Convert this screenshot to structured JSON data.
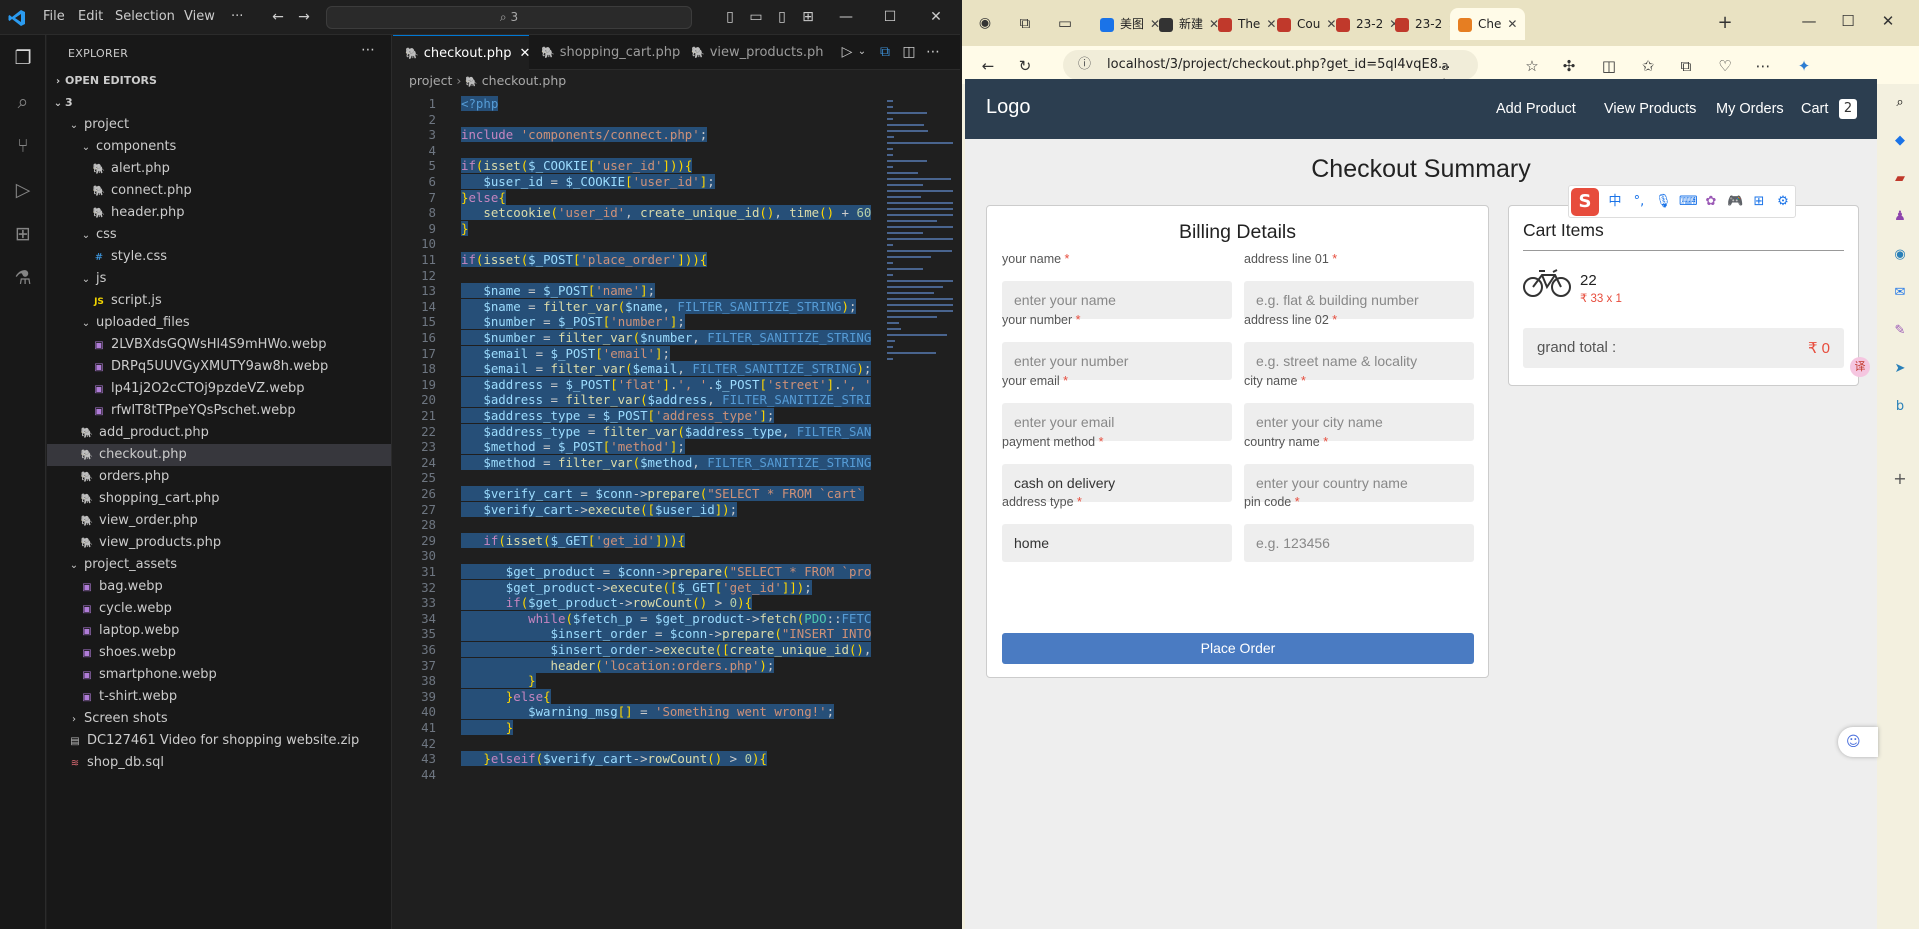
{
  "vscode": {
    "menu": [
      "File",
      "Edit",
      "Selection",
      "View",
      "···"
    ],
    "search": "3",
    "explorer_title": "EXPLORER",
    "open_editors": "OPEN EDITORS",
    "root_folder": "3",
    "tree": [
      {
        "label": "project",
        "depth": 1,
        "type": "folder"
      },
      {
        "label": "components",
        "depth": 2,
        "type": "folder"
      },
      {
        "label": "alert.php",
        "depth": 3,
        "type": "php"
      },
      {
        "label": "connect.php",
        "depth": 3,
        "type": "php"
      },
      {
        "label": "header.php",
        "depth": 3,
        "type": "php"
      },
      {
        "label": "css",
        "depth": 2,
        "type": "folder"
      },
      {
        "label": "style.css",
        "depth": 3,
        "type": "css"
      },
      {
        "label": "js",
        "depth": 2,
        "type": "folder"
      },
      {
        "label": "script.js",
        "depth": 3,
        "type": "js"
      },
      {
        "label": "uploaded_files",
        "depth": 2,
        "type": "folder"
      },
      {
        "label": "2LVBXdsGQWsHl4S9mHWo.webp",
        "depth": 3,
        "type": "img"
      },
      {
        "label": "DRPq5UUVGyXMUTY9aw8h.webp",
        "depth": 3,
        "type": "img"
      },
      {
        "label": "lp41j2O2cCTOj9pzdeVZ.webp",
        "depth": 3,
        "type": "img"
      },
      {
        "label": "rfwIT8tTPpeYQsPschet.webp",
        "depth": 3,
        "type": "img"
      },
      {
        "label": "add_product.php",
        "depth": 2,
        "type": "php"
      },
      {
        "label": "checkout.php",
        "depth": 2,
        "type": "php"
      },
      {
        "label": "orders.php",
        "depth": 2,
        "type": "php"
      },
      {
        "label": "shopping_cart.php",
        "depth": 2,
        "type": "php"
      },
      {
        "label": "view_order.php",
        "depth": 2,
        "type": "php"
      },
      {
        "label": "view_products.php",
        "depth": 2,
        "type": "php"
      },
      {
        "label": "project_assets",
        "depth": 1,
        "type": "folder"
      },
      {
        "label": "bag.webp",
        "depth": 2,
        "type": "img"
      },
      {
        "label": "cycle.webp",
        "depth": 2,
        "type": "img"
      },
      {
        "label": "laptop.webp",
        "depth": 2,
        "type": "img"
      },
      {
        "label": "shoes.webp",
        "depth": 2,
        "type": "img"
      },
      {
        "label": "smartphone.webp",
        "depth": 2,
        "type": "img"
      },
      {
        "label": "t-shirt.webp",
        "depth": 2,
        "type": "img"
      },
      {
        "label": "Screen shots",
        "depth": 1,
        "type": "folder-closed"
      },
      {
        "label": "DC127461 Video for shopping website.zip",
        "depth": 1,
        "type": "zip"
      },
      {
        "label": "shop_db.sql",
        "depth": 1,
        "type": "sql"
      }
    ],
    "tabs": [
      "checkout.php",
      "shopping_cart.php",
      "view_products.ph"
    ],
    "breadcrumb": [
      "project",
      "checkout.php"
    ],
    "code_lines": [
      "<?php",
      "",
      "include 'components/connect.php';",
      "",
      "if(isset($_COOKIE['user_id'])){",
      "   $user_id = $_COOKIE['user_id'];",
      "}else{",
      "   setcookie('user_id', create_unique_id(), time() + 60",
      "}",
      "",
      "if(isset($_POST['place_order'])){",
      "",
      "   $name = $_POST['name'];",
      "   $name = filter_var($name, FILTER_SANITIZE_STRING);",
      "   $number = $_POST['number'];",
      "   $number = filter_var($number, FILTER_SANITIZE_STRING",
      "   $email = $_POST['email'];",
      "   $email = filter_var($email, FILTER_SANITIZE_STRING);",
      "   $address = $_POST['flat'].', '.$_POST['street'].', '",
      "   $address = filter_var($address, FILTER_SANITIZE_STRI",
      "   $address_type = $_POST['address_type'];",
      "   $address_type = filter_var($address_type, FILTER_SAN",
      "   $method = $_POST['method'];",
      "   $method = filter_var($method, FILTER_SANITIZE_STRING",
      "",
      "   $verify_cart = $conn->prepare(\"SELECT * FROM `cart`",
      "   $verify_cart->execute([$user_id]);",
      "",
      "   if(isset($_GET['get_id'])){",
      "",
      "      $get_product = $conn->prepare(\"SELECT * FROM `pro",
      "      $get_product->execute([$_GET['get_id']]);",
      "      if($get_product->rowCount() > 0){",
      "         while($fetch_p = $get_product->fetch(PDO::FETC",
      "            $insert_order = $conn->prepare(\"INSERT INTO",
      "            $insert_order->execute([create_unique_id(),",
      "            header('location:orders.php');",
      "         }",
      "      }else{",
      "         $warning_msg[] = 'Something went wrong!';",
      "      }",
      "",
      "   }elseif($verify_cart->rowCount() > 0){",
      ""
    ]
  },
  "browser": {
    "tabs": [
      {
        "label": "美图",
        "color": "#1a73e8"
      },
      {
        "label": "新建",
        "color": "#333"
      },
      {
        "label": "The",
        "color": "#c0392b"
      },
      {
        "label": "Cou",
        "color": "#c0392b"
      },
      {
        "label": "23-2",
        "color": "#c0392b"
      },
      {
        "label": "23-2",
        "color": "#c0392b"
      },
      {
        "label": "Che",
        "color": "#e67e22"
      }
    ],
    "url": "localhost/3/project/checkout.php?get_id=5ql4vqE8..."
  },
  "site": {
    "logo": "Logo",
    "nav": [
      "Add Product",
      "View Products",
      "My Orders",
      "Cart"
    ],
    "cart_count": "2",
    "title": "Checkout Summary",
    "billing": {
      "title": "Billing Details",
      "fields_left": [
        {
          "label": "your name",
          "placeholder": "enter your name"
        },
        {
          "label": "your number",
          "placeholder": "enter your number"
        },
        {
          "label": "your email",
          "placeholder": "enter your email"
        },
        {
          "label": "payment method",
          "value": "cash on delivery"
        },
        {
          "label": "address type",
          "value": "home"
        }
      ],
      "fields_right": [
        {
          "label": "address line 01",
          "placeholder": "e.g. flat & building number"
        },
        {
          "label": "address line 02",
          "placeholder": "e.g. street name & locality"
        },
        {
          "label": "city name",
          "placeholder": "enter your city name"
        },
        {
          "label": "country name",
          "placeholder": "enter your country name"
        },
        {
          "label": "pin code",
          "placeholder": "e.g. 123456"
        }
      ],
      "required_mark": "*",
      "submit": "Place Order"
    },
    "cart": {
      "title": "Cart Items",
      "item_name": "22",
      "item_price": "₹ 33 x 1",
      "grand_label": "grand total :",
      "grand_value": "₹ 0"
    }
  }
}
